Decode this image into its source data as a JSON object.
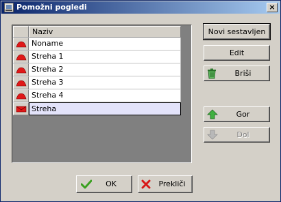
{
  "window": {
    "title": "Pomožni pogledi",
    "close_glyph": "×"
  },
  "list": {
    "header": "Naziv",
    "rows": [
      {
        "name": "Noname",
        "icon": "roof-icon"
      },
      {
        "name": "Streha 1",
        "icon": "roof-icon"
      },
      {
        "name": "Streha 2",
        "icon": "roof-icon"
      },
      {
        "name": "Streha 3",
        "icon": "roof-icon"
      },
      {
        "name": "Streha 4",
        "icon": "roof-icon"
      },
      {
        "name": "Streha",
        "icon": "roof-selected-icon",
        "selected": true
      }
    ]
  },
  "buttons": {
    "new_composed": "Novi sestavljen",
    "edit": "Edit",
    "delete": "Briši",
    "up": "Gor",
    "down": "Dol",
    "ok": "OK",
    "cancel": "Prekliči"
  },
  "colors": {
    "title_start": "#0a246a",
    "title_end": "#a6caf0",
    "roof_red": "#e01818",
    "selection_bg": "#e3e3fa",
    "check_green": "#3aa020",
    "cross_red": "#d81818"
  }
}
